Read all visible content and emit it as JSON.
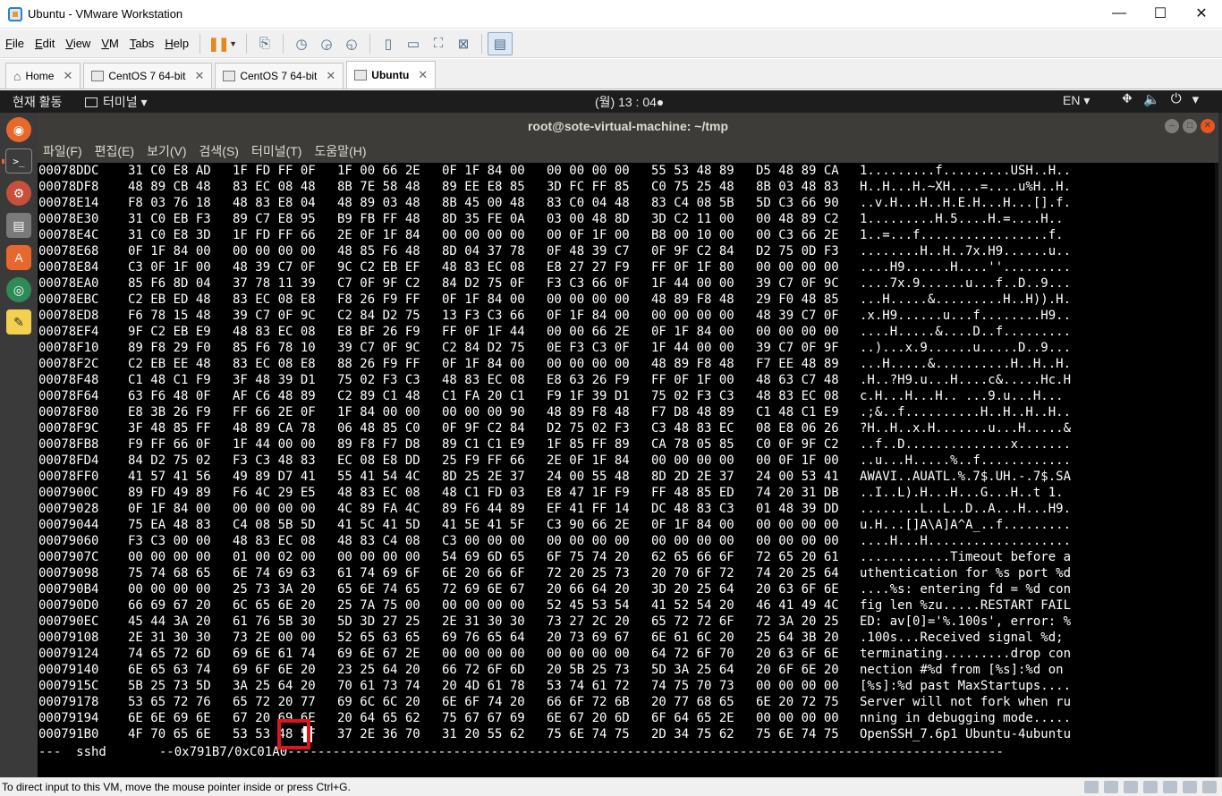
{
  "window": {
    "title": "Ubuntu - VMware Workstation",
    "controls": {
      "minimize": "—",
      "maximize": "☐",
      "close": "✕"
    }
  },
  "menu": [
    {
      "label": "File",
      "u": "F",
      "rest": "ile"
    },
    {
      "label": "Edit",
      "u": "E",
      "rest": "dit"
    },
    {
      "label": "View",
      "u": "V",
      "rest": "iew"
    },
    {
      "label": "VM",
      "u": "V",
      "rest": "M"
    },
    {
      "label": "Tabs",
      "u": "T",
      "rest": "abs"
    },
    {
      "label": "Help",
      "u": "H",
      "rest": "elp"
    }
  ],
  "tabs": [
    {
      "label": "Home",
      "icon": "home-icon"
    },
    {
      "label": "CentOS 7 64-bit",
      "icon": "vm-icon"
    },
    {
      "label": "CentOS 7 64-bit",
      "icon": "vm-icon"
    },
    {
      "label": "Ubuntu",
      "icon": "vm-icon",
      "active": true
    }
  ],
  "guest": {
    "activities": "현재 활동",
    "app_menu": "터미널 ▾",
    "clock": "(월) 13 : 04●",
    "lang": "EN ▾",
    "tray": [
      "⛖",
      "🔈",
      "⏻",
      "▾"
    ]
  },
  "terminal": {
    "title": "root@sote-virtual-machine: ~/tmp",
    "menu": [
      "파일(F)",
      "편집(E)",
      "보기(V)",
      "검색(S)",
      "터미널(T)",
      "도움말(H)"
    ],
    "rows": [
      {
        "addr": "00078DDC",
        "hex": [
          "31 C0 E8 AD",
          "1F FD FF 0F",
          "1F 00 66 2E",
          "0F 1F 84 00",
          "00 00 00 00",
          "55 53 48 89",
          "D5 48 89 CA"
        ],
        "ascii": "1.........f.........USH..H.."
      },
      {
        "addr": "00078DF8",
        "hex": [
          "48 89 CB 48",
          "83 EC 08 48",
          "8B 7E 58 48",
          "89 EE E8 85",
          "3D FC FF 85",
          "C0 75 25 48",
          "8B 03 48 83"
        ],
        "ascii": "H..H...H.~XH....=....u%H..H."
      },
      {
        "addr": "00078E14",
        "hex": [
          "F8 03 76 18",
          "48 83 E8 04",
          "48 89 03 48",
          "8B 45 00 48",
          "83 C0 04 48",
          "83 C4 08 5B",
          "5D C3 66 90"
        ],
        "ascii": "..v.H...H..H.E.H...H...[].f."
      },
      {
        "addr": "00078E30",
        "hex": [
          "31 C0 EB F3",
          "89 C7 E8 95",
          "B9 FB FF 48",
          "8D 35 FE 0A",
          "03 00 48 8D",
          "3D C2 11 00",
          "00 48 89 C2"
        ],
        "ascii": "1.........H.5....H.=....H.."
      },
      {
        "addr": "00078E4C",
        "hex": [
          "31 C0 E8 3D",
          "1F FD FF 66",
          "2E 0F 1F 84",
          "00 00 00 00",
          "00 0F 1F 00",
          "B8 00 10 00",
          "00 C3 66 2E"
        ],
        "ascii": "1..=...f.................f."
      },
      {
        "addr": "00078E68",
        "hex": [
          "0F 1F 84 00",
          "00 00 00 00",
          "48 85 F6 48",
          "8D 04 37 78",
          "0F 48 39 C7",
          "0F 9F C2 84",
          "D2 75 0D F3"
        ],
        "ascii": "........H..H..7x.H9......u.."
      },
      {
        "addr": "00078E84",
        "hex": [
          "C3 0F 1F 00",
          "48 39 C7 0F",
          "9C C2 EB EF",
          "48 83 EC 08",
          "E8 27 27 F9",
          "FF 0F 1F 80",
          "00 00 00 00"
        ],
        "ascii": "....H9......H....''........."
      },
      {
        "addr": "00078EA0",
        "hex": [
          "85 F6 8D 04",
          "37 78 11 39",
          "C7 0F 9F C2",
          "84 D2 75 0F",
          "F3 C3 66 0F",
          "1F 44 00 00",
          "39 C7 0F 9C"
        ],
        "ascii": "....7x.9......u...f..D..9..."
      },
      {
        "addr": "00078EBC",
        "hex": [
          "C2 EB ED 48",
          "83 EC 08 E8",
          "F8 26 F9 FF",
          "0F 1F 84 00",
          "00 00 00 00",
          "48 89 F8 48",
          "29 F0 48 85"
        ],
        "ascii": "...H.....&.........H..H)).H."
      },
      {
        "addr": "00078ED8",
        "hex": [
          "F6 78 15 48",
          "39 C7 0F 9C",
          "C2 84 D2 75",
          "13 F3 C3 66",
          "0F 1F 84 00",
          "00 00 00 00",
          "48 39 C7 0F"
        ],
        "ascii": ".x.H9......u...f........H9.."
      },
      {
        "addr": "00078EF4",
        "hex": [
          "9F C2 EB E9",
          "48 83 EC 08",
          "E8 BF 26 F9",
          "FF 0F 1F 44",
          "00 00 66 2E",
          "0F 1F 84 00",
          "00 00 00 00"
        ],
        "ascii": "....H.....&....D..f........."
      },
      {
        "addr": "00078F10",
        "hex": [
          "89 F8 29 F0",
          "85 F6 78 10",
          "39 C7 0F 9C",
          "C2 84 D2 75",
          "0E F3 C3 0F",
          "1F 44 00 00",
          "39 C7 0F 9F"
        ],
        "ascii": "..)...x.9......u.....D..9..."
      },
      {
        "addr": "00078F2C",
        "hex": [
          "C2 EB EE 48",
          "83 EC 08 E8",
          "88 26 F9 FF",
          "0F 1F 84 00",
          "00 00 00 00",
          "48 89 F8 48",
          "F7 EE 48 89"
        ],
        "ascii": "...H.....&..........H..H..H."
      },
      {
        "addr": "00078F48",
        "hex": [
          "C1 48 C1 F9",
          "3F 48 39 D1",
          "75 02 F3 C3",
          "48 83 EC 08",
          "E8 63 26 F9",
          "FF 0F 1F 00",
          "48 63 C7 48"
        ],
        "ascii": ".H..?H9.u...H....c&.....Hc.H"
      },
      {
        "addr": "00078F64",
        "hex": [
          "63 F6 48 0F",
          "AF C6 48 89",
          "C2 89 C1 48",
          "C1 FA 20 C1",
          "F9 1F 39 D1",
          "75 02 F3 C3",
          "48 83 EC 08"
        ],
        "ascii": "c.H...H...H.. ...9.u...H..."
      },
      {
        "addr": "00078F80",
        "hex": [
          "E8 3B 26 F9",
          "FF 66 2E 0F",
          "1F 84 00 00",
          "00 00 00 90",
          "48 89 F8 48",
          "F7 D8 48 89",
          "C1 48 C1 E9"
        ],
        "ascii": ".;&..f..........H..H..H..H.."
      },
      {
        "addr": "00078F9C",
        "hex": [
          "3F 48 85 FF",
          "48 89 CA 78",
          "06 48 85 C0",
          "0F 9F C2 84",
          "D2 75 02 F3",
          "C3 48 83 EC",
          "08 E8 06 26"
        ],
        "ascii": "?H..H..x.H.......u...H.....&"
      },
      {
        "addr": "00078FB8",
        "hex": [
          "F9 FF 66 0F",
          "1F 44 00 00",
          "89 F8 F7 D8",
          "89 C1 C1 E9",
          "1F 85 FF 89",
          "CA 78 05 85",
          "C0 0F 9F C2"
        ],
        "ascii": "..f..D..............x......."
      },
      {
        "addr": "00078FD4",
        "hex": [
          "84 D2 75 02",
          "F3 C3 48 83",
          "EC 08 E8 DD",
          "25 F9 FF 66",
          "2E 0F 1F 84",
          "00 00 00 00",
          "00 0F 1F 00"
        ],
        "ascii": "..u...H.....%..f............"
      },
      {
        "addr": "00078FF0",
        "hex": [
          "41 57 41 56",
          "49 89 D7 41",
          "55 41 54 4C",
          "8D 25 2E 37",
          "24 00 55 48",
          "8D 2D 2E 37",
          "24 00 53 41"
        ],
        "ascii": "AWAVI..AUATL.%.7$.UH.-.7$.SA"
      },
      {
        "addr": "0007900C",
        "hex": [
          "89 FD 49 89",
          "F6 4C 29 E5",
          "48 83 EC 08",
          "48 C1 FD 03",
          "E8 47 1F F9",
          "FF 48 85 ED",
          "74 20 31 DB"
        ],
        "ascii": "..I..L).H...H...G...H..t 1."
      },
      {
        "addr": "00079028",
        "hex": [
          "0F 1F 84 00",
          "00 00 00 00",
          "4C 89 FA 4C",
          "89 F6 44 89",
          "EF 41 FF 14",
          "DC 48 83 C3",
          "01 48 39 DD"
        ],
        "ascii": "........L..L..D..A...H...H9."
      },
      {
        "addr": "00079044",
        "hex": [
          "75 EA 48 83",
          "C4 08 5B 5D",
          "41 5C 41 5D",
          "41 5E 41 5F",
          "C3 90 66 2E",
          "0F 1F 84 00",
          "00 00 00 00"
        ],
        "ascii": "u.H...[]A\\A]A^A_..f........."
      },
      {
        "addr": "00079060",
        "hex": [
          "F3 C3 00 00",
          "48 83 EC 08",
          "48 83 C4 08",
          "C3 00 00 00",
          "00 00 00 00",
          "00 00 00 00",
          "00 00 00 00"
        ],
        "ascii": "....H...H..................."
      },
      {
        "addr": "0007907C",
        "hex": [
          "00 00 00 00",
          "01 00 02 00",
          "00 00 00 00",
          "54 69 6D 65",
          "6F 75 74 20",
          "62 65 66 6F",
          "72 65 20 61"
        ],
        "ascii": "............Timeout before a"
      },
      {
        "addr": "00079098",
        "hex": [
          "75 74 68 65",
          "6E 74 69 63",
          "61 74 69 6F",
          "6E 20 66 6F",
          "72 20 25 73",
          "20 70 6F 72",
          "74 20 25 64"
        ],
        "ascii": "uthentication for %s port %d"
      },
      {
        "addr": "000790B4",
        "hex": [
          "00 00 00 00",
          "25 73 3A 20",
          "65 6E 74 65",
          "72 69 6E 67",
          "20 66 64 20",
          "3D 20 25 64",
          "20 63 6F 6E"
        ],
        "ascii": "....%s: entering fd = %d con"
      },
      {
        "addr": "000790D0",
        "hex": [
          "66 69 67 20",
          "6C 65 6E 20",
          "25 7A 75 00",
          "00 00 00 00",
          "52 45 53 54",
          "41 52 54 20",
          "46 41 49 4C"
        ],
        "ascii": "fig len %zu.....RESTART FAIL"
      },
      {
        "addr": "000790EC",
        "hex": [
          "45 44 3A 20",
          "61 76 5B 30",
          "5D 3D 27 25",
          "2E 31 30 30",
          "73 27 2C 20",
          "65 72 72 6F",
          "72 3A 20 25"
        ],
        "ascii": "ED: av[0]='%.100s', error: %"
      },
      {
        "addr": "00079108",
        "hex": [
          "2E 31 30 30",
          "73 2E 00 00",
          "52 65 63 65",
          "69 76 65 64",
          "20 73 69 67",
          "6E 61 6C 20",
          "25 64 3B 20"
        ],
        "ascii": ".100s...Received signal %d; "
      },
      {
        "addr": "00079124",
        "hex": [
          "74 65 72 6D",
          "69 6E 61 74",
          "69 6E 67 2E",
          "00 00 00 00",
          "00 00 00 00",
          "64 72 6F 70",
          "20 63 6F 6E"
        ],
        "ascii": "terminating.........drop con"
      },
      {
        "addr": "00079140",
        "hex": [
          "6E 65 63 74",
          "69 6F 6E 20",
          "23 25 64 20",
          "66 72 6F 6D",
          "20 5B 25 73",
          "5D 3A 25 64",
          "20 6F 6E 20"
        ],
        "ascii": "nection #%d from [%s]:%d on "
      },
      {
        "addr": "0007915C",
        "hex": [
          "5B 25 73 5D",
          "3A 25 64 20",
          "70 61 73 74",
          "20 4D 61 78",
          "53 74 61 72",
          "74 75 70 73",
          "00 00 00 00"
        ],
        "ascii": "[%s]:%d past MaxStartups...."
      },
      {
        "addr": "00079178",
        "hex": [
          "53 65 72 76",
          "65 72 20 77",
          "69 6C 6C 20",
          "6E 6F 74 20",
          "66 6F 72 6B",
          "20 77 68 65",
          "6E 20 72 75"
        ],
        "ascii": "Server will not fork when ru"
      },
      {
        "addr": "00079194",
        "hex": [
          "6E 6E 69 6E",
          "67 20 69 6E",
          "20 64 65 62",
          "75 67 67 69",
          "6E 67 20 6D",
          "6F 64 65 2E",
          "00 00 00 00"
        ],
        "ascii": "nning in debugging mode....."
      },
      {
        "addr": "000791B0",
        "hex": [
          "4F 70 65 6E",
          "53 53 48 5F",
          "37 2E 36 70",
          "31 20 55 62",
          "75 6E 74 75",
          "2D 34 75 62",
          "75 6E 74 75"
        ],
        "ascii": "OpenSSH_7.6p1 Ubuntu-4ubuntu"
      }
    ],
    "status_line": "---  sshd       --0x791B7/0xC01A0-----------------------------------------------------------------------------------------------",
    "cursor_char": "5"
  },
  "statusbar": {
    "message": "To direct input to this VM, move the mouse pointer inside or press Ctrl+G."
  }
}
